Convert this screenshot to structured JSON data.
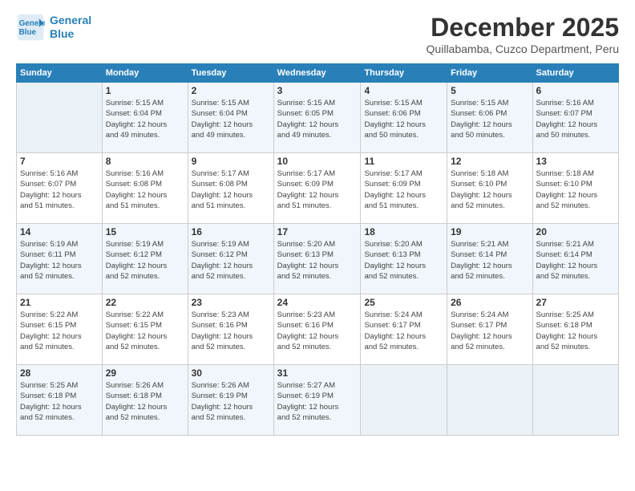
{
  "logo": {
    "line1": "General",
    "line2": "Blue"
  },
  "title": "December 2025",
  "subtitle": "Quillabamba, Cuzco Department, Peru",
  "days_of_week": [
    "Sunday",
    "Monday",
    "Tuesday",
    "Wednesday",
    "Thursday",
    "Friday",
    "Saturday"
  ],
  "weeks": [
    [
      {
        "day": "",
        "info": ""
      },
      {
        "day": "1",
        "info": "Sunrise: 5:15 AM\nSunset: 6:04 PM\nDaylight: 12 hours\nand 49 minutes."
      },
      {
        "day": "2",
        "info": "Sunrise: 5:15 AM\nSunset: 6:04 PM\nDaylight: 12 hours\nand 49 minutes."
      },
      {
        "day": "3",
        "info": "Sunrise: 5:15 AM\nSunset: 6:05 PM\nDaylight: 12 hours\nand 49 minutes."
      },
      {
        "day": "4",
        "info": "Sunrise: 5:15 AM\nSunset: 6:06 PM\nDaylight: 12 hours\nand 50 minutes."
      },
      {
        "day": "5",
        "info": "Sunrise: 5:15 AM\nSunset: 6:06 PM\nDaylight: 12 hours\nand 50 minutes."
      },
      {
        "day": "6",
        "info": "Sunrise: 5:16 AM\nSunset: 6:07 PM\nDaylight: 12 hours\nand 50 minutes."
      }
    ],
    [
      {
        "day": "7",
        "info": "Sunrise: 5:16 AM\nSunset: 6:07 PM\nDaylight: 12 hours\nand 51 minutes."
      },
      {
        "day": "8",
        "info": "Sunrise: 5:16 AM\nSunset: 6:08 PM\nDaylight: 12 hours\nand 51 minutes."
      },
      {
        "day": "9",
        "info": "Sunrise: 5:17 AM\nSunset: 6:08 PM\nDaylight: 12 hours\nand 51 minutes."
      },
      {
        "day": "10",
        "info": "Sunrise: 5:17 AM\nSunset: 6:09 PM\nDaylight: 12 hours\nand 51 minutes."
      },
      {
        "day": "11",
        "info": "Sunrise: 5:17 AM\nSunset: 6:09 PM\nDaylight: 12 hours\nand 51 minutes."
      },
      {
        "day": "12",
        "info": "Sunrise: 5:18 AM\nSunset: 6:10 PM\nDaylight: 12 hours\nand 52 minutes."
      },
      {
        "day": "13",
        "info": "Sunrise: 5:18 AM\nSunset: 6:10 PM\nDaylight: 12 hours\nand 52 minutes."
      }
    ],
    [
      {
        "day": "14",
        "info": "Sunrise: 5:19 AM\nSunset: 6:11 PM\nDaylight: 12 hours\nand 52 minutes."
      },
      {
        "day": "15",
        "info": "Sunrise: 5:19 AM\nSunset: 6:12 PM\nDaylight: 12 hours\nand 52 minutes."
      },
      {
        "day": "16",
        "info": "Sunrise: 5:19 AM\nSunset: 6:12 PM\nDaylight: 12 hours\nand 52 minutes."
      },
      {
        "day": "17",
        "info": "Sunrise: 5:20 AM\nSunset: 6:13 PM\nDaylight: 12 hours\nand 52 minutes."
      },
      {
        "day": "18",
        "info": "Sunrise: 5:20 AM\nSunset: 6:13 PM\nDaylight: 12 hours\nand 52 minutes."
      },
      {
        "day": "19",
        "info": "Sunrise: 5:21 AM\nSunset: 6:14 PM\nDaylight: 12 hours\nand 52 minutes."
      },
      {
        "day": "20",
        "info": "Sunrise: 5:21 AM\nSunset: 6:14 PM\nDaylight: 12 hours\nand 52 minutes."
      }
    ],
    [
      {
        "day": "21",
        "info": "Sunrise: 5:22 AM\nSunset: 6:15 PM\nDaylight: 12 hours\nand 52 minutes."
      },
      {
        "day": "22",
        "info": "Sunrise: 5:22 AM\nSunset: 6:15 PM\nDaylight: 12 hours\nand 52 minutes."
      },
      {
        "day": "23",
        "info": "Sunrise: 5:23 AM\nSunset: 6:16 PM\nDaylight: 12 hours\nand 52 minutes."
      },
      {
        "day": "24",
        "info": "Sunrise: 5:23 AM\nSunset: 6:16 PM\nDaylight: 12 hours\nand 52 minutes."
      },
      {
        "day": "25",
        "info": "Sunrise: 5:24 AM\nSunset: 6:17 PM\nDaylight: 12 hours\nand 52 minutes."
      },
      {
        "day": "26",
        "info": "Sunrise: 5:24 AM\nSunset: 6:17 PM\nDaylight: 12 hours\nand 52 minutes."
      },
      {
        "day": "27",
        "info": "Sunrise: 5:25 AM\nSunset: 6:18 PM\nDaylight: 12 hours\nand 52 minutes."
      }
    ],
    [
      {
        "day": "28",
        "info": "Sunrise: 5:25 AM\nSunset: 6:18 PM\nDaylight: 12 hours\nand 52 minutes."
      },
      {
        "day": "29",
        "info": "Sunrise: 5:26 AM\nSunset: 6:18 PM\nDaylight: 12 hours\nand 52 minutes."
      },
      {
        "day": "30",
        "info": "Sunrise: 5:26 AM\nSunset: 6:19 PM\nDaylight: 12 hours\nand 52 minutes."
      },
      {
        "day": "31",
        "info": "Sunrise: 5:27 AM\nSunset: 6:19 PM\nDaylight: 12 hours\nand 52 minutes."
      },
      {
        "day": "",
        "info": ""
      },
      {
        "day": "",
        "info": ""
      },
      {
        "day": "",
        "info": ""
      }
    ]
  ]
}
